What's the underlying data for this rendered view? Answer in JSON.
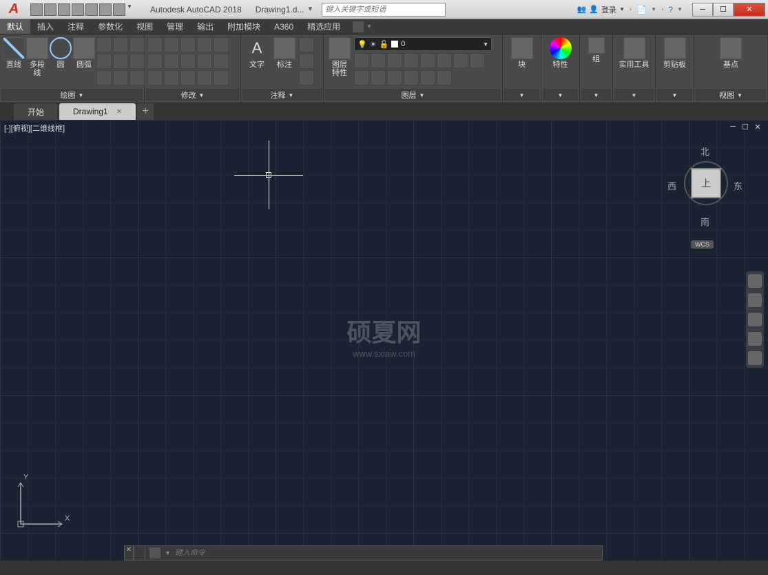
{
  "titlebar": {
    "app_name": "Autodesk AutoCAD 2018",
    "document": "Drawing1.d...",
    "search_placeholder": "键入关键字或短语",
    "login_label": "登录"
  },
  "menu": {
    "tabs": [
      "默认",
      "插入",
      "注释",
      "参数化",
      "视图",
      "管理",
      "输出",
      "附加模块",
      "A360",
      "精选应用"
    ]
  },
  "ribbon": {
    "draw": {
      "title": "绘图",
      "line": "直线",
      "polyline": "多段线",
      "circle": "圆",
      "arc": "圆弧"
    },
    "modify": {
      "title": "修改"
    },
    "annotate": {
      "title": "注释",
      "text": "文字",
      "dim": "标注"
    },
    "layers": {
      "title": "图层",
      "props": "图层\n特性",
      "current": "0"
    },
    "block": {
      "title": "块",
      "label": "块"
    },
    "properties": {
      "title": "特性",
      "label": "特性"
    },
    "group": {
      "title": "组",
      "label": "组"
    },
    "utilities": {
      "title": "实用工具",
      "label": "实用工具"
    },
    "clipboard": {
      "title": "剪贴板",
      "label": "剪贴板"
    },
    "view": {
      "title": "视图",
      "label": "基点"
    }
  },
  "filetabs": {
    "start": "开始",
    "drawing": "Drawing1"
  },
  "viewport": {
    "label": "[-][俯视][二维线框]",
    "cube_top": "上",
    "compass": {
      "n": "北",
      "s": "南",
      "e": "东",
      "w": "西"
    },
    "wcs": "WCS",
    "ucs_y": "Y",
    "ucs_x": "X"
  },
  "watermark": {
    "title": "硕夏网",
    "url": "www.sxiaw.com"
  },
  "commandline": {
    "placeholder": "键入命令"
  },
  "view_panel_title": "视图"
}
